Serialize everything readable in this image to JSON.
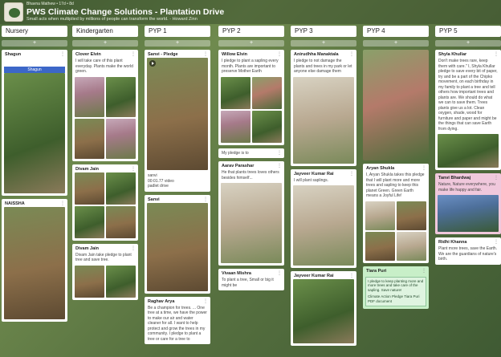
{
  "header": {
    "meta": "Bhavna Mathew • 17d • 8d",
    "title": "PWS Climate Change Solutions - Plantation Drive",
    "subtitle": "Small acts when multiplied by millions of people can transform the world. - Howard Zinn"
  },
  "add_symbol": "+",
  "menu_symbol": "⋮",
  "columns": [
    {
      "name": "Nursery",
      "cards": [
        {
          "name": "Shagun",
          "phone_title": "Shagun"
        },
        {
          "name": "NAISSHA"
        }
      ]
    },
    {
      "name": "Kindergarten",
      "cards": [
        {
          "name": "Clover Elvin",
          "text": "I will take care of this plant everyday. Plants make the world green."
        },
        {
          "name": "Divam Jain"
        },
        {
          "name": "Divam Jain",
          "text": "Divam Jain take pledge to plant tree and save tree."
        }
      ]
    },
    {
      "name": "PYP 1",
      "cards": [
        {
          "name": "Sanvi - Pledge",
          "video_time": "00:01.77 video",
          "video_label": "padlet drive",
          "overlay_prefix": "sanvi"
        },
        {
          "name": "Sanvi"
        },
        {
          "name": "Raghav Arya",
          "text": "Be a champion for trees. ... One tree at a time, we have the power to make our air and water cleaner for all. I want to help protect and grow the trees in my community. I pledge to plant a tree or care for a tree to"
        }
      ]
    },
    {
      "name": "PYP 2",
      "cards": [
        {
          "name": "Willow Elvin",
          "text": "I pledge to plant a sapling every month. Plants are important to preserve Mother Earth"
        },
        {
          "name": "",
          "text": "My pledge is to"
        },
        {
          "name": "Aarav Parashar",
          "text": "He that plants trees loves others besides himself..."
        },
        {
          "name": "Vivaan Mishra",
          "text": "To plant a tree, Small or big it might be"
        }
      ]
    },
    {
      "name": "PYP 3",
      "cards": [
        {
          "name": "Anirudhha Manaktala",
          "text": "I pledge to not damage the plants and trees in my park or let anyone else damage them"
        },
        {
          "name": "Jayveer Kumar Rai",
          "text": "I will plant saplings."
        },
        {
          "name": "Jayveer Kumar Rai"
        }
      ]
    },
    {
      "name": "PYP 4",
      "cards": [
        {
          "name": "Aryan Shukla",
          "text": "I, Aryan Shukla takes this pledge that I will plant more and more trees and sapling to keep this planet Green. Green Earth means a Joyful Life!"
        },
        {
          "name": "Tiara Puri",
          "doc_text": "I pledge to keep planting more and more trees and take care of the sapling. Save nature!",
          "doc_sub": "Climate Action Pledge Tiara Puri PDF document"
        }
      ]
    },
    {
      "name": "PYP 5",
      "cards": [
        {
          "name": "Shyla Khullar",
          "text": "Don't make trees rare, keep them with care.\" I, Shyla Khullar pledge to save every bit of paper, try and be a part of the Chipko movement, on each birthday in my family to plant a tree and tell others how important trees and plants are. We should do what we can to save them. Trees plants give us a lot. Clean oxygen, shade, wood for furniture and paper and might be the things that can save Earth from dying."
        },
        {
          "name": "Tanvi Bhardwaj",
          "text": "Nature, Nature everywhere, you make life happy and fair."
        },
        {
          "name": "Ridhi Khanna",
          "text": "Plant more trees, save the Earth. We are the guardians of nature's birth."
        }
      ]
    }
  ]
}
